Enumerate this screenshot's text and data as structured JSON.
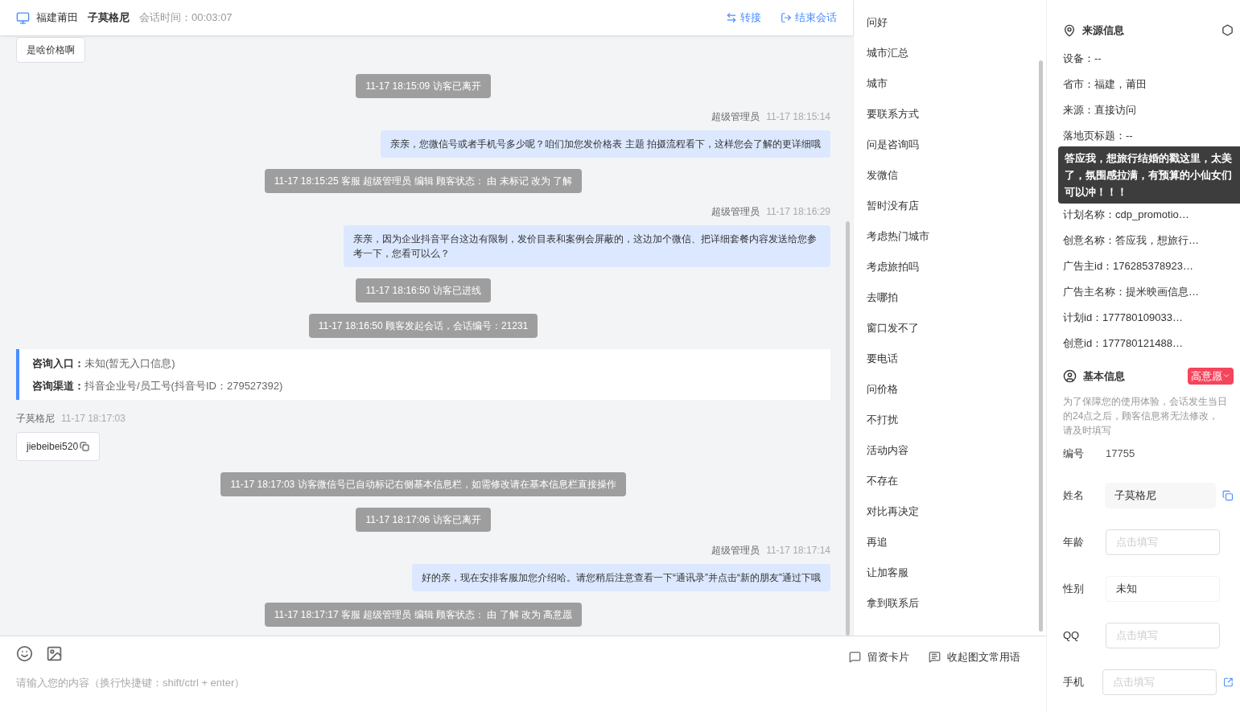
{
  "header": {
    "location": "福建莆田",
    "visitor": "子莫格尼",
    "session_label": "会话时间：",
    "session_time": "00:03:07",
    "actions": [
      {
        "kind": "transfer",
        "label": "转接"
      },
      {
        "kind": "end",
        "label": "结束会话"
      }
    ]
  },
  "messages": [
    {
      "kind": "visitor_text",
      "text": "是啥价格啊"
    },
    {
      "kind": "system",
      "text": "11-17 18:15:09 访客已离开"
    },
    {
      "kind": "agent",
      "name": "超级管理员",
      "time": "11-17 18:15:14",
      "text": "亲亲，您微信号或者手机号多少呢？咱们加您发价格表 主题 拍摄流程看下，这样您会了解的更详细哦"
    },
    {
      "kind": "system",
      "text": "11-17 18:15:25 客服 超级管理员 编辑 顾客状态： 由 未标记 改为 了解"
    },
    {
      "kind": "agent",
      "name": "超级管理员",
      "time": "11-17 18:16:29",
      "text": "亲亲，因为企业抖音平台这边有限制，发价目表和案例会屏蔽的，这边加个微信、把详细套餐内容发送给您参考一下，您看可以么？"
    },
    {
      "kind": "system",
      "text": "11-17 18:16:50 访客已进线"
    },
    {
      "kind": "system",
      "text": "11-17 18:16:50 顾客发起会话，会话编号：21231"
    },
    {
      "kind": "info",
      "rows": [
        {
          "label": "咨询入口：",
          "value": "未知(暂无入口信息)"
        },
        {
          "label": "咨询渠道：",
          "value": "抖音企业号/员工号(抖音号ID：279527392)"
        }
      ]
    },
    {
      "kind": "visitor",
      "name": "子莫格尼",
      "time": "11-17 18:17:03",
      "text": "jiebeibei520"
    },
    {
      "kind": "system",
      "text": "11-17 18:17:03 访客微信号已自动标记右侧基本信息栏，如需修改请在基本信息栏直接操作"
    },
    {
      "kind": "system",
      "text": "11-17 18:17:06 访客已离开"
    },
    {
      "kind": "agent",
      "name": "超级管理员",
      "time": "11-17 18:17:14",
      "text": "好的亲，现在安排客服加您介绍哈。请您稍后注意查看一下“通讯录”并点击“新的朋友”通过下哦"
    },
    {
      "kind": "system",
      "text": "11-17 18:17:17 客服 超级管理员 编辑 顾客状态： 由 了解 改为 高意愿"
    }
  ],
  "composer": {
    "placeholder": "请输入您的内容（换行快捷键：shift/ctrl + enter）",
    "actions": [
      {
        "kind": "card",
        "label": "留资卡片"
      },
      {
        "kind": "collapse",
        "label": "收起图文常用语"
      }
    ]
  },
  "phrases": [
    "问好",
    "城市汇总",
    "城市",
    "要联系方式",
    "问是咨询吗",
    "发微信",
    "暂时没有店",
    "考虑热门城市",
    "考虑旅拍吗",
    "去哪拍",
    "窗口发不了",
    "要电话",
    "问价格",
    "不打扰",
    "活动内容",
    "不存在",
    "对比再决定",
    "再追",
    "让加客服",
    "拿到联系后"
  ],
  "source": {
    "title": "来源信息",
    "rows": [
      {
        "kind": "row",
        "text": "设备：--"
      },
      {
        "kind": "row",
        "text": "省市：福建，莆田"
      },
      {
        "kind": "row",
        "text": "来源：直接访问"
      },
      {
        "kind": "row",
        "text": "落地页标题：--"
      },
      {
        "kind": "tooltip",
        "lines": [
          "答应我，想旅行结婚的戳这里，太美",
          "了，氛围感拉满，有预算的小仙女们",
          "可以冲！！！"
        ]
      },
      {
        "kind": "row",
        "text": "计划名称：cdp_promotio…"
      },
      {
        "kind": "row",
        "text": "创意名称：答应我，想旅行…"
      },
      {
        "kind": "row",
        "text": "广告主id：176285378923…"
      },
      {
        "kind": "row",
        "text": "广告主名称：提米映画信息…"
      },
      {
        "kind": "row",
        "text": "计划id：177780109033…"
      },
      {
        "kind": "row",
        "text": "创意id：177780121488…"
      }
    ]
  },
  "basic": {
    "title": "基本信息",
    "intent": "高意愿",
    "note": "为了保障您的使用体验，会话发生当日的24点之后，顾客信息将无法修改，请及时填写",
    "fields": [
      {
        "kind": "static",
        "label": "编号",
        "value": "17755"
      },
      {
        "kind": "readonly",
        "label": "姓名",
        "value": "子莫格尼"
      },
      {
        "kind": "input",
        "label": "年龄",
        "placeholder": "点击填写"
      },
      {
        "kind": "select",
        "label": "性别",
        "value": "未知"
      },
      {
        "kind": "input",
        "label": "QQ",
        "placeholder": "点击填写"
      },
      {
        "kind": "input_link",
        "label": "手机",
        "placeholder": "点击填写"
      }
    ]
  }
}
